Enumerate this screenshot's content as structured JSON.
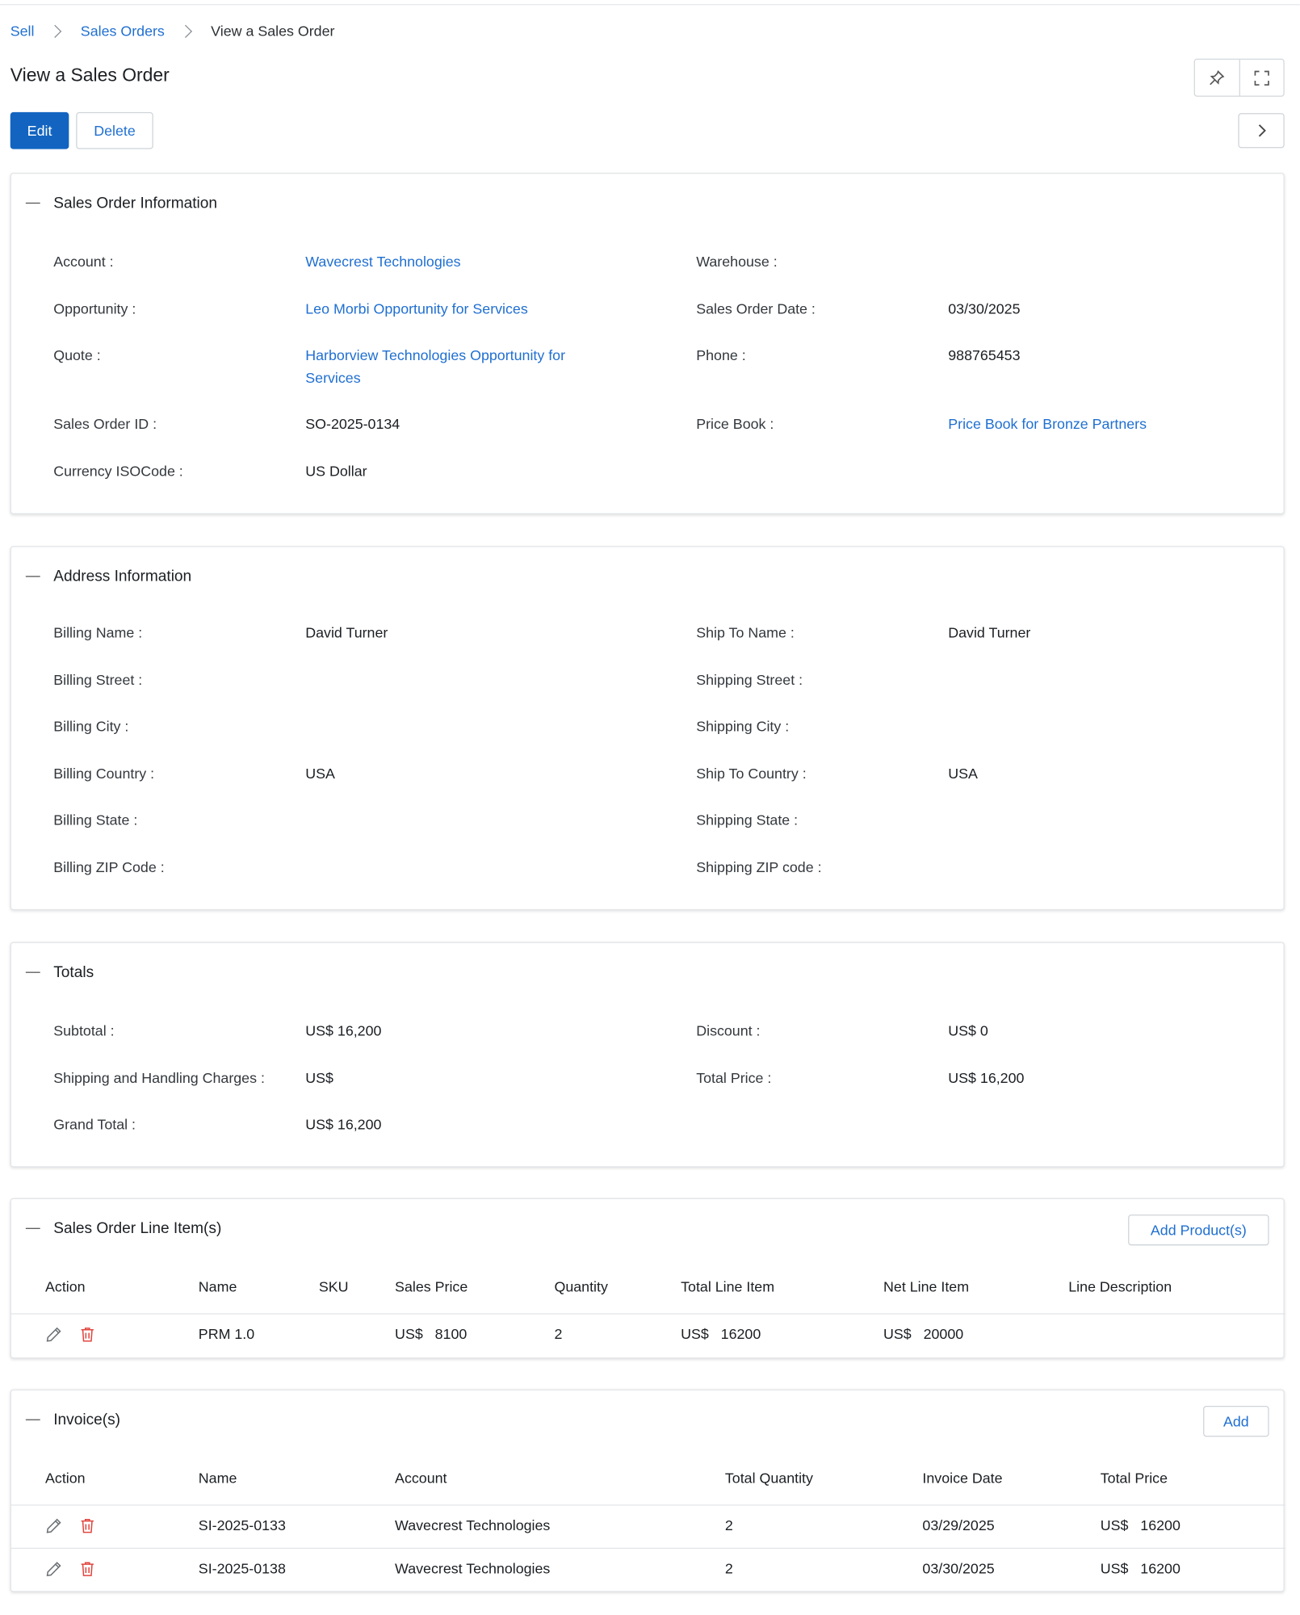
{
  "breadcrumb": {
    "sell": "Sell",
    "sales_orders": "Sales Orders",
    "current": "View a Sales Order"
  },
  "page": {
    "title": "View a Sales Order"
  },
  "toolbar": {
    "edit_label": "Edit",
    "delete_label": "Delete"
  },
  "info": {
    "title": "Sales Order Information",
    "account_label": "Account :",
    "account_value": "Wavecrest Technologies",
    "warehouse_label": "Warehouse :",
    "opportunity_label": "Opportunity :",
    "opportunity_value": "Leo Morbi Opportunity for Services",
    "so_date_label": "Sales Order Date :",
    "so_date_value": "03/30/2025",
    "quote_label": "Quote :",
    "quote_value_line1": "Harborview Technologies Opportunity for",
    "quote_value_line2": "Services",
    "phone_label": "Phone :",
    "phone_value": "988765453",
    "so_id_label": "Sales Order ID :",
    "so_id_value": "SO-2025-0134",
    "price_book_label": "Price Book :",
    "price_book_value": "Price Book for Bronze Partners",
    "currency_label": "Currency ISOCode :",
    "currency_value": "US Dollar"
  },
  "address": {
    "title": "Address Information",
    "billing_name_label": "Billing Name :",
    "billing_name_value": "David Turner",
    "ship_to_name_label": "Ship To Name :",
    "ship_to_name_value": "David Turner",
    "billing_street_label": "Billing Street :",
    "shipping_street_label": "Shipping Street :",
    "billing_city_label": "Billing City :",
    "shipping_city_label": "Shipping City :",
    "billing_country_label": "Billing Country :",
    "billing_country_value": "USA",
    "ship_to_country_label": "Ship To Country :",
    "ship_to_country_value": "USA",
    "billing_state_label": "Billing State :",
    "shipping_state_label": "Shipping State :",
    "billing_zip_label": "Billing ZIP Code :",
    "shipping_zip_label": "Shipping ZIP code :"
  },
  "totals": {
    "title": "Totals",
    "subtotal_label": "Subtotal :",
    "subtotal_value": "US$ 16,200",
    "discount_label": "Discount :",
    "discount_value": "US$ 0",
    "shipping_label": "Shipping and Handling Charges :",
    "shipping_value": "US$",
    "total_price_label": "Total Price :",
    "total_price_value": "US$ 16,200",
    "grand_total_label": "Grand Total :",
    "grand_total_value": "US$ 16,200"
  },
  "line_items": {
    "title": "Sales Order Line Item(s)",
    "add_label": "Add Product(s)",
    "columns": [
      "Action",
      "Name",
      "SKU",
      "Sales Price",
      "Quantity",
      "Total Line Item",
      "Net Line Item",
      "Line Description"
    ],
    "rows": [
      {
        "name": "PRM 1.0",
        "sku": "",
        "price_cur": "US$",
        "price": "8100",
        "qty": "2",
        "total_cur": "US$",
        "total": "16200",
        "net_cur": "US$",
        "net": "20000",
        "desc": ""
      }
    ]
  },
  "invoices": {
    "title": "Invoice(s)",
    "add_label": "Add",
    "columns": [
      "Action",
      "Name",
      "Account",
      "Total Quantity",
      "Invoice Date",
      "Total Price"
    ],
    "rows": [
      {
        "name": "SI-2025-0133",
        "account": "Wavecrest Technologies",
        "qty": "2",
        "date": "03/29/2025",
        "cur": "US$",
        "price": "16200"
      },
      {
        "name": "SI-2025-0138",
        "account": "Wavecrest Technologies",
        "qty": "2",
        "date": "03/30/2025",
        "cur": "US$",
        "price": "16200"
      }
    ]
  },
  "colors": {
    "primary": "#1264c0",
    "link": "#1f6fd1",
    "danger": "#e0463f"
  }
}
